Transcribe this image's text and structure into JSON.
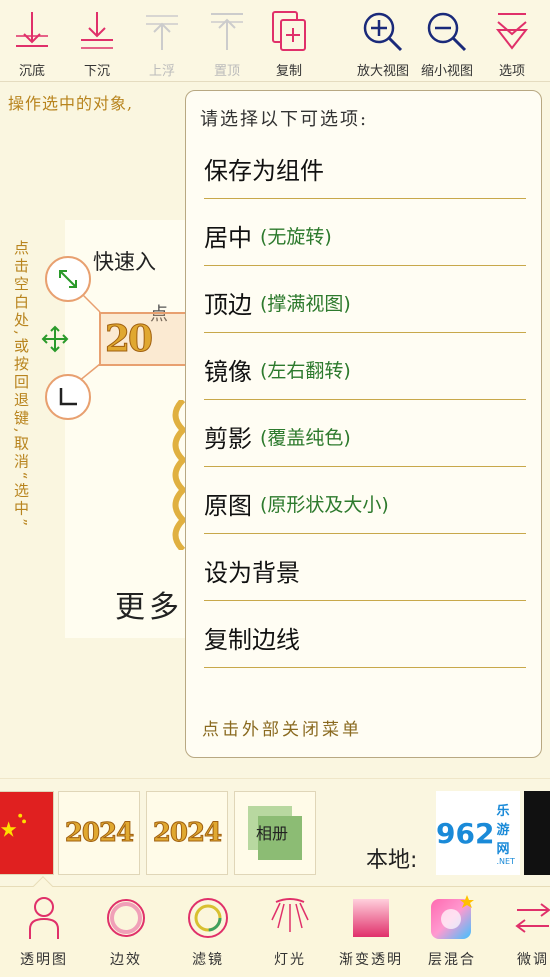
{
  "toolbar": {
    "items": [
      {
        "label": "沉底",
        "icon": "sink-bottom-icon",
        "enabled": true
      },
      {
        "label": "下沉",
        "icon": "move-down-icon",
        "enabled": true
      },
      {
        "label": "上浮",
        "icon": "move-up-icon",
        "enabled": false
      },
      {
        "label": "置顶",
        "icon": "bring-top-icon",
        "enabled": false
      },
      {
        "label": "复制",
        "icon": "copy-icon",
        "enabled": true
      },
      {
        "label": "放大视图",
        "icon": "zoom-in-icon",
        "enabled": true
      },
      {
        "label": "缩小视图",
        "icon": "zoom-out-icon",
        "enabled": true
      },
      {
        "label": "选项",
        "icon": "options-icon",
        "enabled": true
      }
    ]
  },
  "hints": {
    "top": "操作选中的对象,",
    "vertical": "点击空白处,或按回退键,取消“选中”"
  },
  "canvas": {
    "text1": "快速入",
    "text2": "更多",
    "text3": "点",
    "selected_label": "20"
  },
  "menu": {
    "title": "请选择以下可选项:",
    "items": [
      {
        "main": "保存为组件",
        "sub": ""
      },
      {
        "main": "居中",
        "sub": "(无旋转)"
      },
      {
        "main": "顶边",
        "sub": "(撑满视图)"
      },
      {
        "main": "镜像",
        "sub": "(左右翻转)"
      },
      {
        "main": "剪影",
        "sub": "(覆盖纯色)"
      },
      {
        "main": "原图",
        "sub": "(原形状及大小)"
      },
      {
        "main": "设为背景",
        "sub": ""
      },
      {
        "main": "复制边线",
        "sub": ""
      }
    ],
    "footer": "点击外部关闭菜单"
  },
  "strip": {
    "thumb1": "2024",
    "thumb2": "2024",
    "album_label": "相册",
    "local_label": "本地:",
    "logo_text": "乐游网",
    "logo_sub": ".NET",
    "logo_num": "962"
  },
  "bottombar": {
    "items": [
      {
        "label": "透明图",
        "icon": "person-icon"
      },
      {
        "label": "边效",
        "icon": "border-effect-icon"
      },
      {
        "label": "滤镜",
        "icon": "filter-icon"
      },
      {
        "label": "灯光",
        "icon": "light-icon"
      },
      {
        "label": "渐变透明",
        "icon": "gradient-icon"
      },
      {
        "label": "层混合",
        "icon": "layer-blend-icon"
      },
      {
        "label": "微调",
        "icon": "fine-tune-icon"
      }
    ]
  },
  "colors": {
    "accent": "#e0306a",
    "menu_sub": "#2d7a2d",
    "hint": "#b8841e",
    "divider": "#c8a84a"
  }
}
